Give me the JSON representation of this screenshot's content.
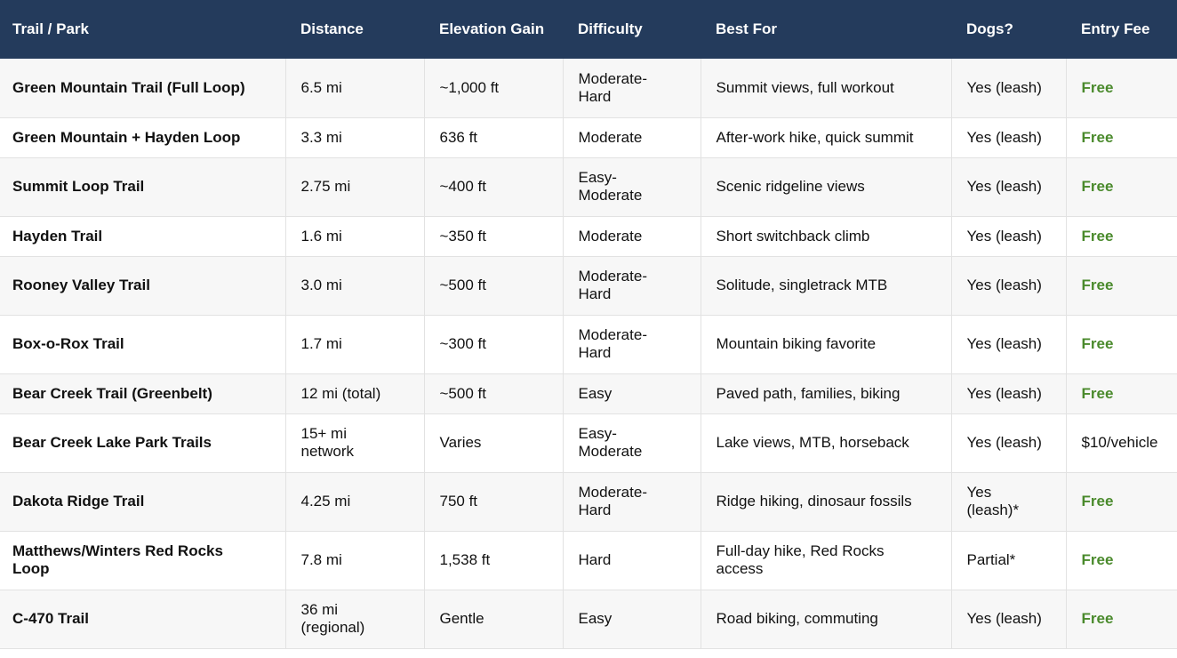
{
  "headers": [
    "Trail / Park",
    "Distance",
    "Elevation Gain",
    "Difficulty",
    "Best For",
    "Dogs?",
    "Entry Fee"
  ],
  "colors": {
    "header_bg": "#243b5c",
    "free_text": "#4a8a2c"
  },
  "rows": [
    {
      "trail": "Green Mountain Trail (Full Loop)",
      "distance": "6.5 mi",
      "elevation": "~1,000 ft",
      "difficulty": "Moderate-Hard",
      "best_for": "Summit views, full workout",
      "dogs": "Yes (leash)",
      "fee": "Free"
    },
    {
      "trail": "Green Mountain + Hayden Loop",
      "distance": "3.3 mi",
      "elevation": "636 ft",
      "difficulty": "Moderate",
      "best_for": "After-work hike, quick summit",
      "dogs": "Yes (leash)",
      "fee": "Free"
    },
    {
      "trail": "Summit Loop Trail",
      "distance": "2.75 mi",
      "elevation": "~400 ft",
      "difficulty": "Easy-Moderate",
      "best_for": "Scenic ridgeline views",
      "dogs": "Yes (leash)",
      "fee": "Free"
    },
    {
      "trail": "Hayden Trail",
      "distance": "1.6 mi",
      "elevation": "~350 ft",
      "difficulty": "Moderate",
      "best_for": "Short switchback climb",
      "dogs": "Yes (leash)",
      "fee": "Free"
    },
    {
      "trail": "Rooney Valley Trail",
      "distance": "3.0 mi",
      "elevation": "~500 ft",
      "difficulty": "Moderate-Hard",
      "best_for": "Solitude, singletrack MTB",
      "dogs": "Yes (leash)",
      "fee": "Free"
    },
    {
      "trail": "Box-o-Rox Trail",
      "distance": "1.7 mi",
      "elevation": "~300 ft",
      "difficulty": "Moderate-Hard",
      "best_for": "Mountain biking favorite",
      "dogs": "Yes (leash)",
      "fee": "Free"
    },
    {
      "trail": "Bear Creek Trail (Greenbelt)",
      "distance": "12 mi (total)",
      "elevation": "~500 ft",
      "difficulty": "Easy",
      "best_for": "Paved path, families, biking",
      "dogs": "Yes (leash)",
      "fee": "Free"
    },
    {
      "trail": "Bear Creek Lake Park Trails",
      "distance": "15+ mi network",
      "elevation": "Varies",
      "difficulty": "Easy-Moderate",
      "best_for": "Lake views, MTB, horseback",
      "dogs": "Yes (leash)",
      "fee": "$10/vehicle"
    },
    {
      "trail": "Dakota Ridge Trail",
      "distance": "4.25 mi",
      "elevation": "750 ft",
      "difficulty": "Moderate-Hard",
      "best_for": "Ridge hiking, dinosaur fossils",
      "dogs": "Yes (leash)*",
      "fee": "Free"
    },
    {
      "trail": "Matthews/Winters Red Rocks Loop",
      "distance": "7.8 mi",
      "elevation": "1,538 ft",
      "difficulty": "Hard",
      "best_for": "Full-day hike, Red Rocks access",
      "dogs": "Partial*",
      "fee": "Free"
    },
    {
      "trail": "C-470 Trail",
      "distance": "36 mi (regional)",
      "elevation": "Gentle",
      "difficulty": "Easy",
      "best_for": "Road biking, commuting",
      "dogs": "Yes (leash)",
      "fee": "Free"
    }
  ]
}
